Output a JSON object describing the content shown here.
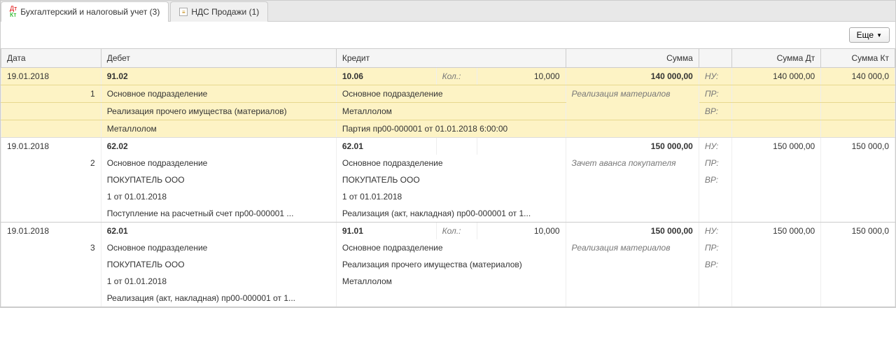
{
  "tabs": [
    {
      "label": "Бухгалтерский и налоговый учет (3)"
    },
    {
      "label": "НДС Продажи (1)"
    }
  ],
  "toolbar": {
    "more": "Еще"
  },
  "headers": {
    "date": "Дата",
    "debet": "Дебет",
    "kredit": "Кредит",
    "sum": "Сумма",
    "sum_dt": "Сумма Дт",
    "sum_kt": "Сумма Кт"
  },
  "labels": {
    "kol": "Кол.:",
    "nu": "НУ:",
    "pr": "ПР:",
    "vr": "ВР:"
  },
  "rows": [
    {
      "selected": true,
      "date": "19.01.2018",
      "num": "1",
      "debet": "91.02",
      "kredit": "10.06",
      "kol": "10,000",
      "sum": "140 000,00",
      "sum_dt": "140 000,00",
      "sum_kt": "140 000,0",
      "comment": "Реализация материалов",
      "debet_rows": [
        "Основное подразделение",
        "Реализация прочего имущества (материалов)",
        "Металлолом"
      ],
      "kredit_rows": [
        "Основное подразделение",
        "Металлолом",
        "Партия пр00-000001 от 01.01.2018 6:00:00"
      ]
    },
    {
      "selected": false,
      "date": "19.01.2018",
      "num": "2",
      "debet": "62.02",
      "kredit": "62.01",
      "kol": "",
      "sum": "150 000,00",
      "sum_dt": "150 000,00",
      "sum_kt": "150 000,0",
      "comment": "Зачет аванса покупателя",
      "debet_rows": [
        "Основное подразделение",
        "ПОКУПАТЕЛЬ ООО",
        "1 от 01.01.2018",
        "Поступление на расчетный счет пр00-000001 ..."
      ],
      "kredit_rows": [
        "Основное подразделение",
        "ПОКУПАТЕЛЬ ООО",
        "1 от 01.01.2018",
        "Реализация (акт, накладная) пр00-000001 от 1..."
      ]
    },
    {
      "selected": false,
      "date": "19.01.2018",
      "num": "3",
      "debet": "62.01",
      "kredit": "91.01",
      "kol": "10,000",
      "sum": "150 000,00",
      "sum_dt": "150 000,00",
      "sum_kt": "150 000,0",
      "comment": "Реализация материалов",
      "debet_rows": [
        "Основное подразделение",
        "ПОКУПАТЕЛЬ ООО",
        "1 от 01.01.2018",
        "Реализация (акт, накладная) пр00-000001 от 1..."
      ],
      "kredit_rows": [
        "Основное подразделение",
        "Реализация прочего имущества (материалов)",
        "Металлолом"
      ]
    }
  ]
}
